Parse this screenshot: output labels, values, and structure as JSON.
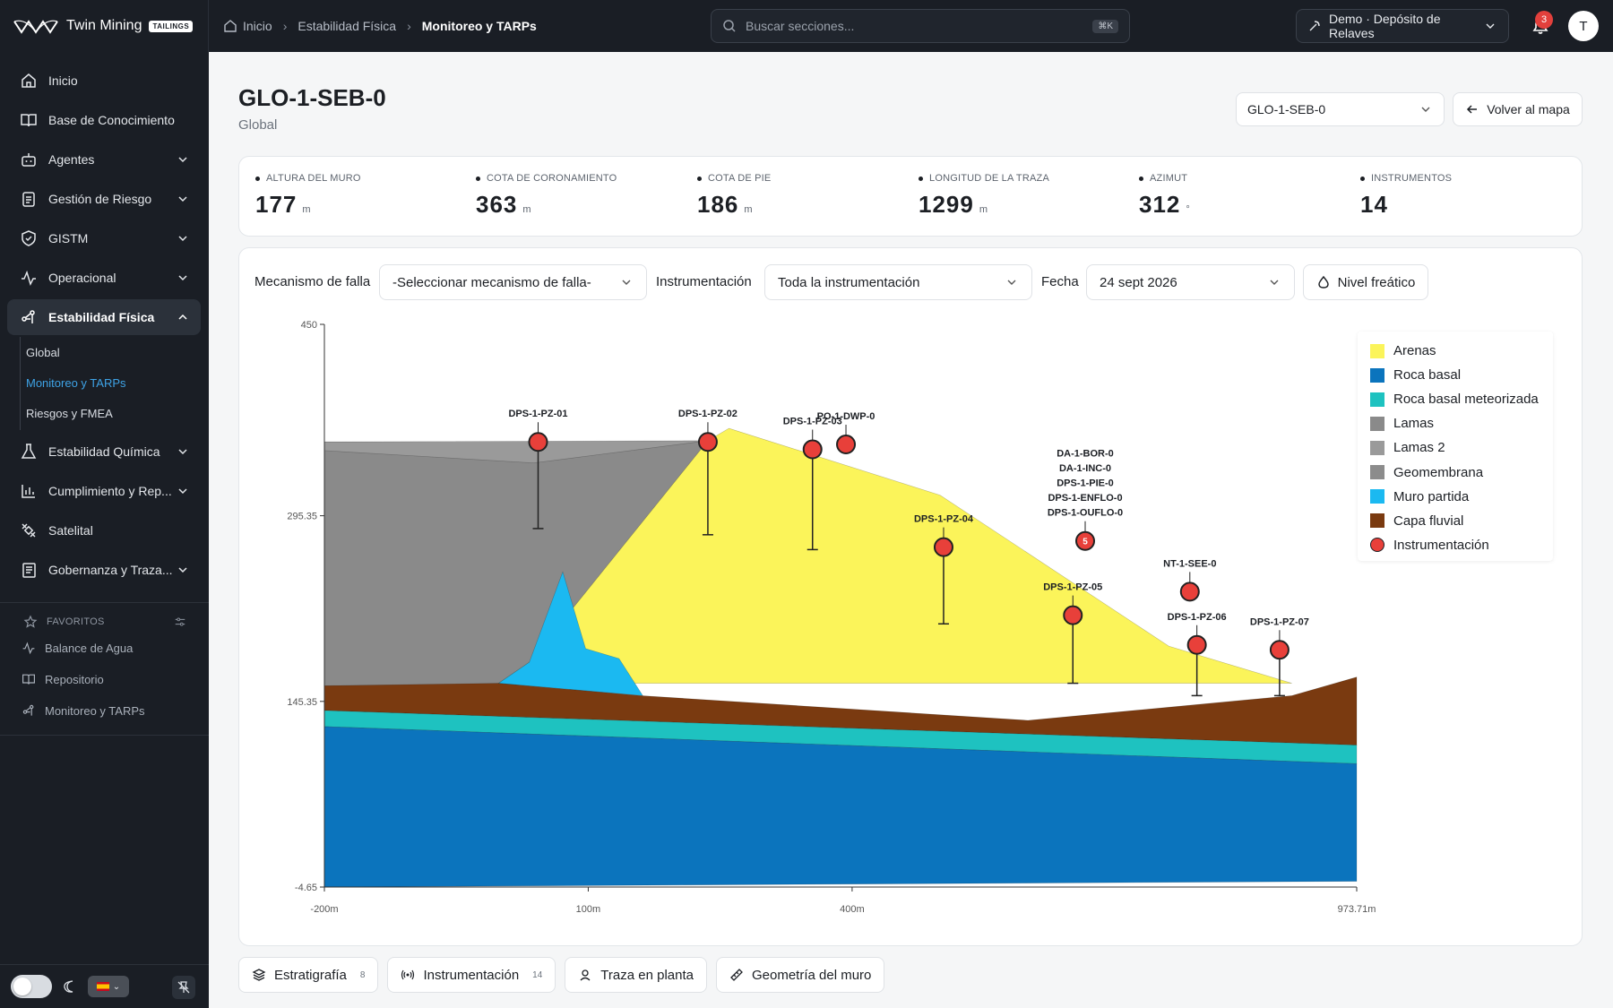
{
  "brand": {
    "name": "Twin Mining",
    "badge": "TAILINGS"
  },
  "breadcrumb": [
    "Inicio",
    "Estabilidad Física",
    "Monitoreo y TARPs"
  ],
  "search": {
    "placeholder": "Buscar secciones...",
    "shortcut": "⌘K"
  },
  "site": {
    "label": "Demo · Depósito de Relaves"
  },
  "notifications": {
    "count": "3"
  },
  "user": {
    "initial": "T"
  },
  "sidebar": {
    "items": [
      {
        "label": "Inicio",
        "icon": "home-icon",
        "expandable": false
      },
      {
        "label": "Base de Conocimiento",
        "icon": "book-icon",
        "expandable": false
      },
      {
        "label": "Agentes",
        "icon": "robot-icon",
        "expandable": true
      },
      {
        "label": "Gestión de Riesgo",
        "icon": "clipboard-icon",
        "expandable": true
      },
      {
        "label": "GISTM",
        "icon": "shield-check-icon",
        "expandable": true
      },
      {
        "label": "Operacional",
        "icon": "activity-icon",
        "expandable": true
      },
      {
        "label": "Estabilidad Física",
        "icon": "network-icon",
        "expandable": true,
        "active": true
      },
      {
        "label": "Estabilidad Química",
        "icon": "flask-icon",
        "expandable": true
      },
      {
        "label": "Cumplimiento y Rep...",
        "icon": "bar-chart-icon",
        "expandable": true
      },
      {
        "label": "Satelital",
        "icon": "satellite-icon",
        "expandable": false
      },
      {
        "label": "Gobernanza y Traza...",
        "icon": "document-list-icon",
        "expandable": true
      }
    ],
    "subitems": [
      "Global",
      "Monitoreo y TARPs",
      "Riesgos y FMEA"
    ],
    "favorites_title": "FAVORITOS",
    "favorites": [
      "Balance de Agua",
      "Repositorio",
      "Monitoreo y TARPs"
    ]
  },
  "page": {
    "title": "GLO-1-SEB-0",
    "subtitle": "Global",
    "station_value": "GLO-1-SEB-0",
    "back_label": "Volver al mapa"
  },
  "stats": [
    {
      "label": "ALTURA DEL MURO",
      "value": "177",
      "unit": "m"
    },
    {
      "label": "COTA DE CORONAMIENTO",
      "value": "363",
      "unit": "m"
    },
    {
      "label": "COTA DE PIE",
      "value": "186",
      "unit": "m"
    },
    {
      "label": "LONGITUD DE LA TRAZA",
      "value": "1299",
      "unit": "m"
    },
    {
      "label": "AZIMUT",
      "value": "312",
      "unit": "°"
    },
    {
      "label": "INSTRUMENTOS",
      "value": "14",
      "unit": ""
    }
  ],
  "filters": {
    "mechanism_label": "Mecanismo de falla",
    "mechanism_value": "-Seleccionar mecanismo de falla-",
    "instr_label": "Instrumentación",
    "instr_value": "Toda la instrumentación",
    "date_label": "Fecha",
    "date_value": "24 sept 2026",
    "nivel_label": "Nivel freático"
  },
  "chart_data": {
    "type": "area",
    "xlim": [
      -200,
      973.71
    ],
    "ylim": [
      -4.65,
      450
    ],
    "x_ticks": [
      -200,
      100,
      400,
      973.71
    ],
    "x_tick_labels": [
      "-200m",
      "100m",
      "400m",
      "973.71m"
    ],
    "y_ticks": [
      -4.65,
      145.35,
      295.35,
      450
    ],
    "y_tick_labels": [
      "-4.65",
      "145.35",
      "295.35",
      "450"
    ],
    "legend_position": "top-right",
    "layers": [
      {
        "name": "Lamas",
        "color": "#8a8a8a",
        "points": [
          [
            -200,
            355
          ],
          [
            236,
            355
          ],
          [
            236,
            200
          ],
          [
            14,
            158
          ],
          [
            -200,
            158
          ]
        ]
      },
      {
        "name": "Lamas 2",
        "color": "#9a9a9a",
        "points": [
          [
            -200,
            355
          ],
          [
            236,
            356
          ],
          [
            38,
            338
          ],
          [
            -200,
            348
          ]
        ]
      },
      {
        "name": "Arenas",
        "color": "#fbf45a",
        "points": [
          [
            33,
            177
          ],
          [
            236,
            356
          ],
          [
            260,
            366
          ],
          [
            500,
            312
          ],
          [
            760,
            190
          ],
          [
            900,
            160
          ],
          [
            -2,
            160
          ]
        ]
      },
      {
        "name": "Muro partida",
        "color": "#1bb9f1",
        "points": [
          [
            -2,
            160
          ],
          [
            33,
            177
          ],
          [
            71,
            250
          ],
          [
            97,
            188
          ],
          [
            135,
            180
          ],
          [
            162,
            150
          ],
          [
            -2,
            160
          ]
        ]
      },
      {
        "name": "Capa fluvial",
        "color": "#7a3a10",
        "points": [
          [
            -200,
            158
          ],
          [
            -2,
            160
          ],
          [
            160,
            150
          ],
          [
            600,
            130
          ],
          [
            900,
            150
          ],
          [
            973.71,
            165
          ],
          [
            973.71,
            110
          ],
          [
            -200,
            138
          ]
        ]
      },
      {
        "name": "Roca basal meteorizada",
        "color": "#1ec2c0",
        "points": [
          [
            -200,
            138
          ],
          [
            973.71,
            110
          ],
          [
            973.71,
            95
          ],
          [
            -200,
            125
          ]
        ]
      },
      {
        "name": "Roca basal",
        "color": "#0b74bd",
        "points": [
          [
            -200,
            125
          ],
          [
            973.71,
            95
          ],
          [
            973.71,
            0
          ],
          [
            -200,
            -4.65
          ]
        ]
      },
      {
        "name": "Geomembrana",
        "color": "#8c8c8c",
        "points": []
      }
    ],
    "instruments": [
      {
        "name": "DPS-1-PZ-01",
        "x": 43,
        "y": 355,
        "bottom": 285
      },
      {
        "name": "DPS-1-PZ-02",
        "x": 236,
        "y": 355,
        "bottom": 280
      },
      {
        "name": "DPS-1-PZ-03",
        "x": 355,
        "y": 349,
        "bottom": 268
      },
      {
        "name": "PO-1-DWP-0",
        "x": 393,
        "y": 353,
        "bottom": 353
      },
      {
        "name": "DPS-1-PZ-04",
        "x": 504,
        "y": 270,
        "bottom": 208
      },
      {
        "name": "DA-1-BOR-0 / DA-1-INC-0 / DPS-1-PIE-0 / DPS-1-ENFLO-0 / DPS-1-OUFLO-0",
        "x": 665,
        "y": 275,
        "bottom": 275,
        "cluster_count": 5
      },
      {
        "name": "DPS-1-PZ-05",
        "x": 651,
        "y": 215,
        "bottom": 160
      },
      {
        "name": "NT-1-SEE-0",
        "x": 784,
        "y": 234,
        "bottom": 234
      },
      {
        "name": "DPS-1-PZ-06",
        "x": 792,
        "y": 191,
        "bottom": 150
      },
      {
        "name": "DPS-1-PZ-07",
        "x": 886,
        "y": 187,
        "bottom": 150
      }
    ],
    "legend": [
      {
        "name": "Arenas",
        "color": "#fbf45a"
      },
      {
        "name": "Roca basal",
        "color": "#0b74bd"
      },
      {
        "name": "Roca basal meteorizada",
        "color": "#1ec2c0"
      },
      {
        "name": "Lamas",
        "color": "#8a8a8a"
      },
      {
        "name": "Lamas 2",
        "color": "#9a9a9a"
      },
      {
        "name": "Geomembrana",
        "color": "#8c8c8c"
      },
      {
        "name": "Muro partida",
        "color": "#1bb9f1"
      },
      {
        "name": "Capa fluvial",
        "color": "#7a3a10"
      },
      {
        "name": "Instrumentación",
        "color": "#e8403a",
        "round": true
      }
    ]
  },
  "bottom_tabs": [
    {
      "label": "Estratigrafía",
      "count": "8"
    },
    {
      "label": "Instrumentación",
      "count": "14"
    },
    {
      "label": "Traza en planta",
      "count": ""
    },
    {
      "label": "Geometría del muro",
      "count": ""
    }
  ]
}
